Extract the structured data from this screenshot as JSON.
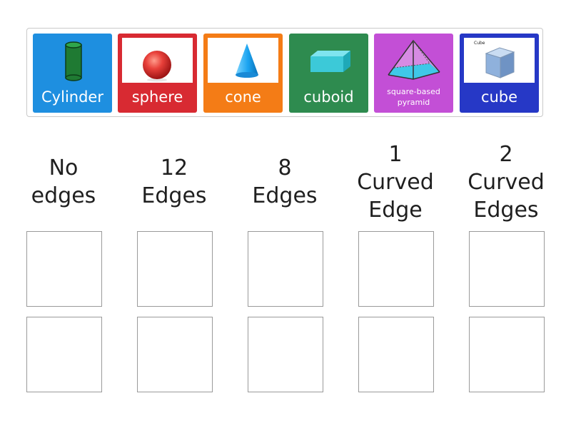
{
  "tray": {
    "cards": [
      {
        "label": "Cylinder",
        "color": "#1e8fe0",
        "icon": "cylinder-icon"
      },
      {
        "label": "sphere",
        "color": "#d82a32",
        "icon": "sphere-icon"
      },
      {
        "label": "cone",
        "color": "#f47c16",
        "icon": "cone-icon"
      },
      {
        "label": "cuboid",
        "color": "#2e8b4f",
        "icon": "cuboid-icon"
      },
      {
        "label": "square-based\npyramid",
        "color": "#c34fd6",
        "icon": "pyramid-icon"
      },
      {
        "label": "cube",
        "color": "#2638c6",
        "icon": "cube-icon",
        "image_caption": "Cube"
      }
    ]
  },
  "columns": [
    {
      "title": "No\nedges"
    },
    {
      "title": "12\nEdges"
    },
    {
      "title": "8\nEdges"
    },
    {
      "title": "1\nCurved\nEdge"
    },
    {
      "title": "2\nCurved\nEdges"
    }
  ]
}
